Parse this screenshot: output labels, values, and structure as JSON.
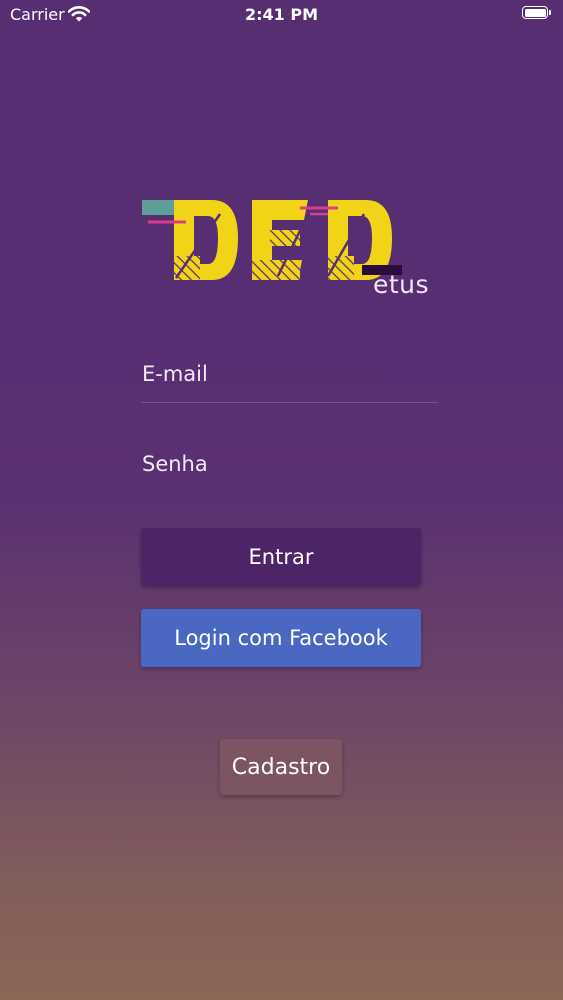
{
  "status_bar": {
    "carrier": "Carrier",
    "time": "2:41 PM"
  },
  "logo": {
    "main": "DED",
    "sub": "etus"
  },
  "form": {
    "email_placeholder": "E-mail",
    "password_placeholder": "Senha"
  },
  "buttons": {
    "login": "Entrar",
    "facebook": "Login com Facebook",
    "signup": "Cadastro"
  },
  "colors": {
    "background_top": "#582e73",
    "background_bottom": "#8c6655",
    "logo_yellow": "#f1d418",
    "accent_teal": "#5d9d9a",
    "accent_pink": "#d63f8b",
    "login_button": "#4d2566",
    "facebook_button": "#4a68c2",
    "signup_button": "#7d5462"
  },
  "icons": [
    "wifi-icon",
    "battery-icon"
  ]
}
